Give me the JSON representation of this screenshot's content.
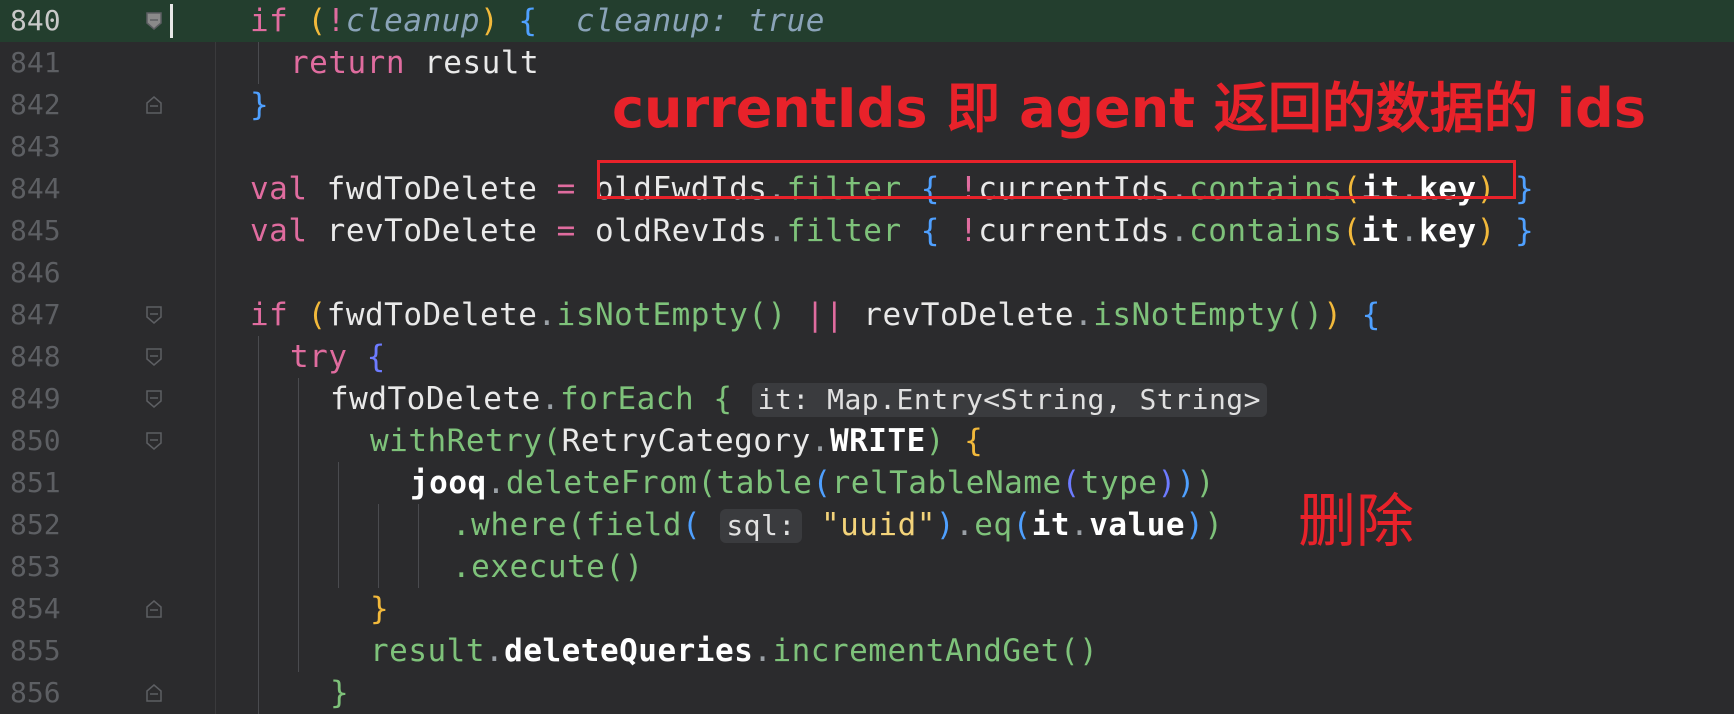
{
  "editor": {
    "current_line": "840",
    "line_numbers": [
      "840",
      "841",
      "842",
      "843",
      "844",
      "845",
      "846",
      "847",
      "848",
      "849",
      "850",
      "851",
      "852",
      "853",
      "854",
      "855",
      "856"
    ],
    "lines": [
      [
        [
          "kw",
          "if"
        ],
        [
          "id",
          " "
        ],
        [
          "b1",
          "("
        ],
        [
          "op",
          "!"
        ],
        [
          "hintc",
          "cleanup"
        ],
        [
          "b1",
          ")"
        ],
        [
          "id",
          " "
        ],
        [
          "b2",
          "{"
        ],
        [
          "id",
          "  "
        ],
        [
          "hintc",
          "cleanup: true"
        ]
      ],
      [
        [
          "kw",
          "return"
        ],
        [
          "id",
          " result"
        ]
      ],
      [
        [
          "b2",
          "}"
        ]
      ],
      [],
      [
        [
          "kw",
          "val"
        ],
        [
          "id",
          " fwdToDelete "
        ],
        [
          "op",
          "="
        ],
        [
          "id",
          " oldFwdIds"
        ],
        [
          "dot",
          "."
        ],
        [
          "fn",
          "filter"
        ],
        [
          "id",
          " "
        ],
        [
          "b2",
          "{"
        ],
        [
          "id",
          " "
        ],
        [
          "op",
          "!"
        ],
        [
          "id",
          "currentIds"
        ],
        [
          "dot",
          "."
        ],
        [
          "fn",
          "contains"
        ],
        [
          "b1",
          "("
        ],
        [
          "bold",
          "it"
        ],
        [
          "dot",
          "."
        ],
        [
          "bold",
          "key"
        ],
        [
          "b1",
          ")"
        ],
        [
          "id",
          " "
        ],
        [
          "b2",
          "}"
        ]
      ],
      [
        [
          "kw",
          "val"
        ],
        [
          "id",
          " revToDelete "
        ],
        [
          "op",
          "="
        ],
        [
          "id",
          " oldRevIds"
        ],
        [
          "dot",
          "."
        ],
        [
          "fn",
          "filter"
        ],
        [
          "id",
          " "
        ],
        [
          "b2",
          "{"
        ],
        [
          "id",
          " "
        ],
        [
          "op",
          "!"
        ],
        [
          "id",
          "currentIds"
        ],
        [
          "dot",
          "."
        ],
        [
          "fn",
          "contains"
        ],
        [
          "b1",
          "("
        ],
        [
          "bold",
          "it"
        ],
        [
          "dot",
          "."
        ],
        [
          "bold",
          "key"
        ],
        [
          "b1",
          ")"
        ],
        [
          "id",
          " "
        ],
        [
          "b2",
          "}"
        ]
      ],
      [],
      [
        [
          "kw",
          "if"
        ],
        [
          "id",
          " "
        ],
        [
          "b1",
          "("
        ],
        [
          "id",
          "fwdToDelete"
        ],
        [
          "dot",
          "."
        ],
        [
          "fn",
          "isNotEmpty"
        ],
        [
          "b3",
          "()"
        ],
        [
          "id",
          " "
        ],
        [
          "op",
          "||"
        ],
        [
          "id",
          " revToDelete"
        ],
        [
          "dot",
          "."
        ],
        [
          "fn",
          "isNotEmpty"
        ],
        [
          "b3",
          "()"
        ],
        [
          "b1",
          ")"
        ],
        [
          "id",
          " "
        ],
        [
          "b2",
          "{"
        ]
      ],
      [
        [
          "kw",
          "try"
        ],
        [
          "id",
          " "
        ],
        [
          "b4",
          "{"
        ]
      ],
      [
        [
          "id",
          "fwdToDelete"
        ],
        [
          "dot",
          "."
        ],
        [
          "fn",
          "forEach"
        ],
        [
          "id",
          " "
        ],
        [
          "b3",
          "{"
        ],
        [
          "id",
          " "
        ],
        [
          "inlay",
          "it: Map.Entry<String, String>"
        ]
      ],
      [
        [
          "fn",
          "withRetry"
        ],
        [
          "b3",
          "("
        ],
        [
          "id",
          "RetryCategory"
        ],
        [
          "dot",
          "."
        ],
        [
          "bold",
          "WRITE"
        ],
        [
          "b3",
          ")"
        ],
        [
          "id",
          " "
        ],
        [
          "b1",
          "{"
        ]
      ],
      [
        [
          "bold",
          "jooq"
        ],
        [
          "dot",
          "."
        ],
        [
          "fn",
          "deleteFrom"
        ],
        [
          "b3",
          "("
        ],
        [
          "fn",
          "table"
        ],
        [
          "b2",
          "("
        ],
        [
          "fn",
          "relTableName"
        ],
        [
          "b4",
          "("
        ],
        [
          "fn",
          "type"
        ],
        [
          "b4",
          ")"
        ],
        [
          "b2",
          ")"
        ],
        [
          "b3",
          ")"
        ]
      ],
      [
        [
          "fn",
          ".where"
        ],
        [
          "b3",
          "("
        ],
        [
          "fn",
          "field"
        ],
        [
          "b2",
          "("
        ],
        [
          "id",
          " "
        ],
        [
          "inlay",
          "sql:"
        ],
        [
          "id",
          " "
        ],
        [
          "str",
          "\"uuid\""
        ],
        [
          "b2",
          ")"
        ],
        [
          "dot",
          "."
        ],
        [
          "fn",
          "eq"
        ],
        [
          "b2",
          "("
        ],
        [
          "bold",
          "it"
        ],
        [
          "dot",
          "."
        ],
        [
          "bold",
          "value"
        ],
        [
          "b2",
          ")"
        ],
        [
          "b3",
          ")"
        ]
      ],
      [
        [
          "fn",
          ".execute"
        ],
        [
          "b3",
          "()"
        ]
      ],
      [
        [
          "b1",
          "}"
        ]
      ],
      [
        [
          "fn",
          "result"
        ],
        [
          "dot",
          "."
        ],
        [
          "bold",
          "deleteQueries"
        ],
        [
          "dot",
          "."
        ],
        [
          "fn",
          "incrementAndGet"
        ],
        [
          "b3",
          "()"
        ]
      ],
      [
        [
          "b3",
          "}"
        ]
      ]
    ]
  },
  "annotations": {
    "box_label": "highlighted-expression",
    "text1": "currentIds 即 agent 返回的数据的 ids",
    "text2": "删除"
  },
  "colors": {
    "background": "#2b2b2d",
    "current_line": "#233e2e",
    "annotation": "#e8222a"
  }
}
